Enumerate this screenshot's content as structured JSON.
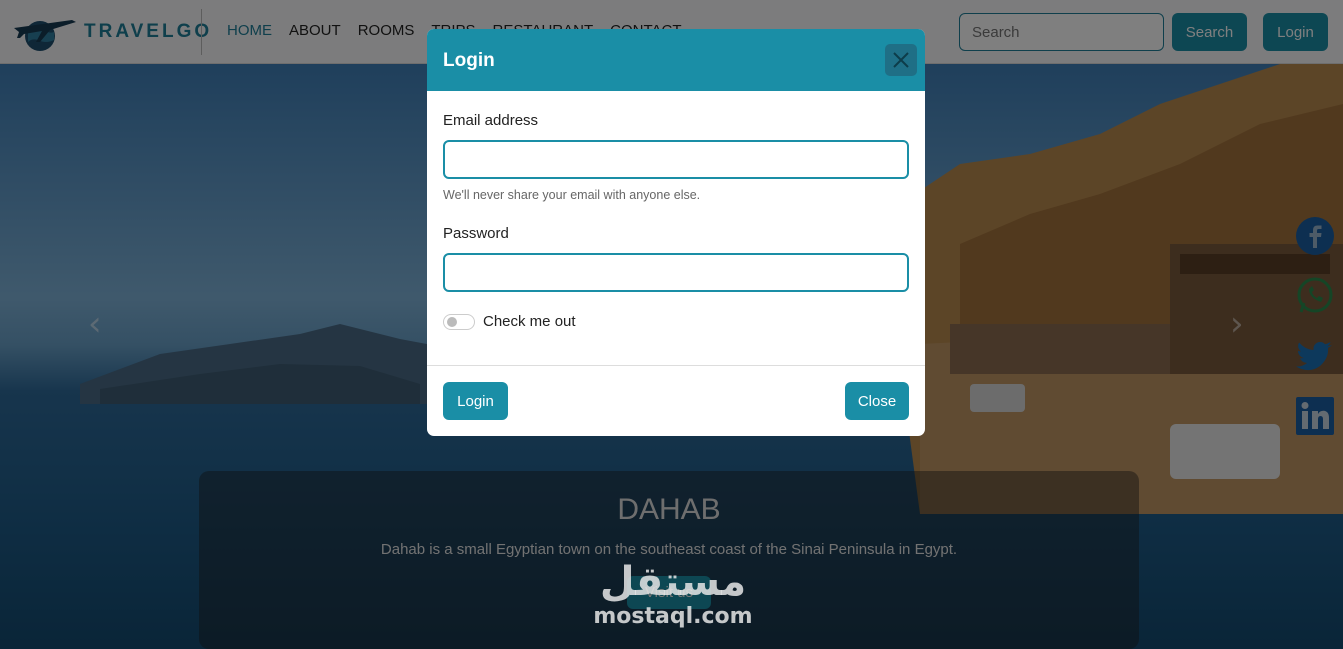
{
  "navbar": {
    "brand": "TRAVELGO",
    "links": [
      "HOME",
      "ABOUT",
      "ROOMS",
      "TRIPS",
      "RESTAURANT",
      "CONTACT"
    ],
    "search_placeholder": "Search",
    "search_button": "Search",
    "login_button": "Login"
  },
  "hero": {
    "title": "DAHAB",
    "description": "Dahab is a small Egyptian town on the southeast coast of the Sinai Peninsula in Egypt.",
    "button": "Visit us"
  },
  "social": [
    "facebook-icon",
    "whatsapp-icon",
    "twitter-icon",
    "linkedin-icon"
  ],
  "modal": {
    "title": "Login",
    "email_label": "Email address",
    "email_value": "",
    "email_help": "We'll never share your email with anyone else.",
    "password_label": "Password",
    "password_value": "",
    "checkbox_label": "Check me out",
    "login_button": "Login",
    "close_button": "Close"
  },
  "watermark": {
    "arabic": "مستقل",
    "latin": "mostaql.com"
  },
  "colors": {
    "primary": "#1a8ea6",
    "brand": "#1e7e98"
  }
}
